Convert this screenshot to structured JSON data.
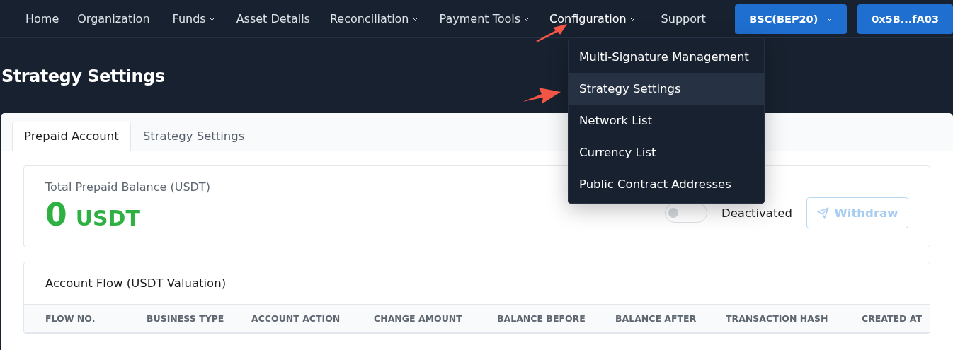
{
  "nav": {
    "items": [
      {
        "label": "Home",
        "has_menu": false,
        "selected": false
      },
      {
        "label": "Organization",
        "has_menu": false,
        "selected": false
      },
      {
        "label": "Funds",
        "has_menu": true,
        "selected": false
      },
      {
        "label": "Asset Details",
        "has_menu": false,
        "selected": false
      },
      {
        "label": "Reconciliation",
        "has_menu": true,
        "selected": false
      },
      {
        "label": "Payment Tools",
        "has_menu": true,
        "selected": false
      },
      {
        "label": "Configuration",
        "has_menu": true,
        "selected": true
      },
      {
        "label": "Support",
        "has_menu": false,
        "selected": false
      }
    ],
    "network_button": "BSC(BEP20)",
    "wallet_button": "0x5B...fA03"
  },
  "dropdown": {
    "items": [
      {
        "label": "Multi-Signature Management",
        "selected": false
      },
      {
        "label": "Strategy Settings",
        "selected": true
      },
      {
        "label": "Network List",
        "selected": false
      },
      {
        "label": "Currency List",
        "selected": false
      },
      {
        "label": "Public Contract Addresses",
        "selected": false
      }
    ]
  },
  "page_title": "Strategy Settings",
  "tabs": [
    {
      "label": "Prepaid Account",
      "selected": true
    },
    {
      "label": "Strategy Settings",
      "selected": false
    }
  ],
  "balance": {
    "label": "Total Prepaid Balance (USDT)",
    "amount": "0",
    "unit": "USDT",
    "toggle": {
      "on": false,
      "label": "Deactivated"
    },
    "withdraw": {
      "label": "Withdraw",
      "disabled": true
    }
  },
  "flow": {
    "title": "Account Flow (USDT Valuation)",
    "columns": [
      "FLOW NO.",
      "BUSINESS TYPE",
      "ACCOUNT ACTION",
      "CHANGE AMOUNT",
      "BALANCE BEFORE",
      "BALANCE AFTER",
      "TRANSACTION HASH",
      "CREATED AT"
    ]
  }
}
